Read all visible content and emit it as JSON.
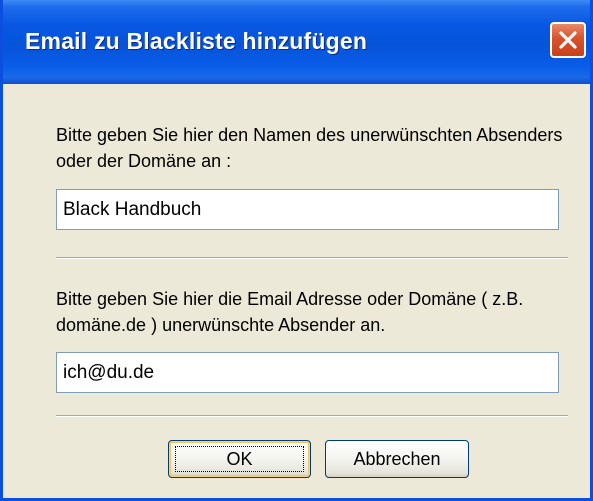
{
  "window": {
    "title": "Email zu Blackliste hinzufügen",
    "close_icon": "close-icon"
  },
  "form": {
    "name_label": "Bitte geben Sie hier den Namen des unerwünschten Absenders oder der Domäne an :",
    "name_value": "Black Handbuch",
    "email_label": "Bitte geben Sie hier die Email Adresse oder Domäne ( z.B. domäne.de ) unerwünschte Absender an.",
    "email_value": "ich@du.de"
  },
  "buttons": {
    "ok_label": "OK",
    "cancel_label": "Abbrechen"
  },
  "colors": {
    "titlebar": "#0654da",
    "dialog_background": "#ece9d8",
    "close_button": "#d8532b"
  }
}
